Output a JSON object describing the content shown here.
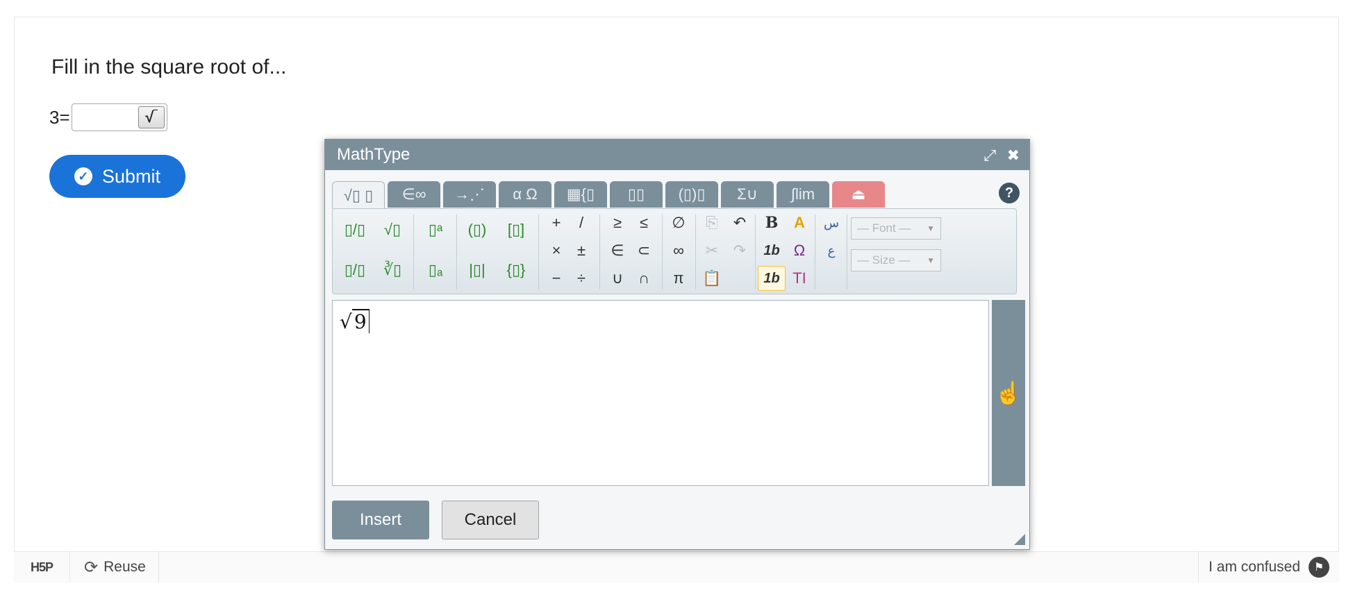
{
  "question": {
    "text": "Fill in the square root of..."
  },
  "equation": {
    "label": "3=",
    "input_value": "",
    "sqrt_button_icon": "sqrt-icon",
    "sqrt_glyph": "√‾"
  },
  "submit": {
    "label": "Submit",
    "icon": "check-circle-icon"
  },
  "footer": {
    "logo": "H5P",
    "reuse_label": "Reuse",
    "reuse_icon": "refresh-icon",
    "confused_label": "I am confused",
    "confused_icon": "flag-icon"
  },
  "mathtype": {
    "title": "MathType",
    "title_controls": [
      "expand-icon",
      "close-icon"
    ],
    "tabs": [
      {
        "label": "√▯ ▯",
        "icon": "root-fraction-tab-icon",
        "active": true
      },
      {
        "label": "∈∞",
        "icon": "symbols-tab-icon"
      },
      {
        "label": "→⋰",
        "icon": "arrows-tab-icon"
      },
      {
        "label": "α Ω",
        "icon": "greek-tab-icon"
      },
      {
        "label": "▦{▯",
        "icon": "matrix-tab-icon"
      },
      {
        "label": "▯▯",
        "icon": "scripts-tab-icon"
      },
      {
        "label": "(▯)▯",
        "icon": "brackets-tab-icon"
      },
      {
        "label": "Σ∪",
        "icon": "operators-tab-icon"
      },
      {
        "label": "∫lim",
        "icon": "calculus-tab-icon"
      },
      {
        "label": "⏏",
        "icon": "custom-tab-icon",
        "color": "#e7878a"
      }
    ],
    "help": "?",
    "toolbar": {
      "buttons": [
        "▯/▯",
        "√▯",
        "▯ᵃ",
        "(▯)",
        "[▯]",
        "+",
        "/",
        "≥",
        "≤",
        "∅",
        "▯/▯",
        "∛▯",
        "▯ₐ",
        "|▯|",
        "{▯}",
        "×",
        "±",
        "∈",
        "⊂",
        "∞",
        "−",
        "÷",
        "∪",
        "∩",
        "π"
      ],
      "font_select": "— Font —",
      "size_select": "— Size —"
    },
    "formula": "9",
    "insert_label": "Insert",
    "cancel_label": "Cancel",
    "colors": {
      "header": "#7b8f9b",
      "accent": "#1a73d9"
    }
  }
}
